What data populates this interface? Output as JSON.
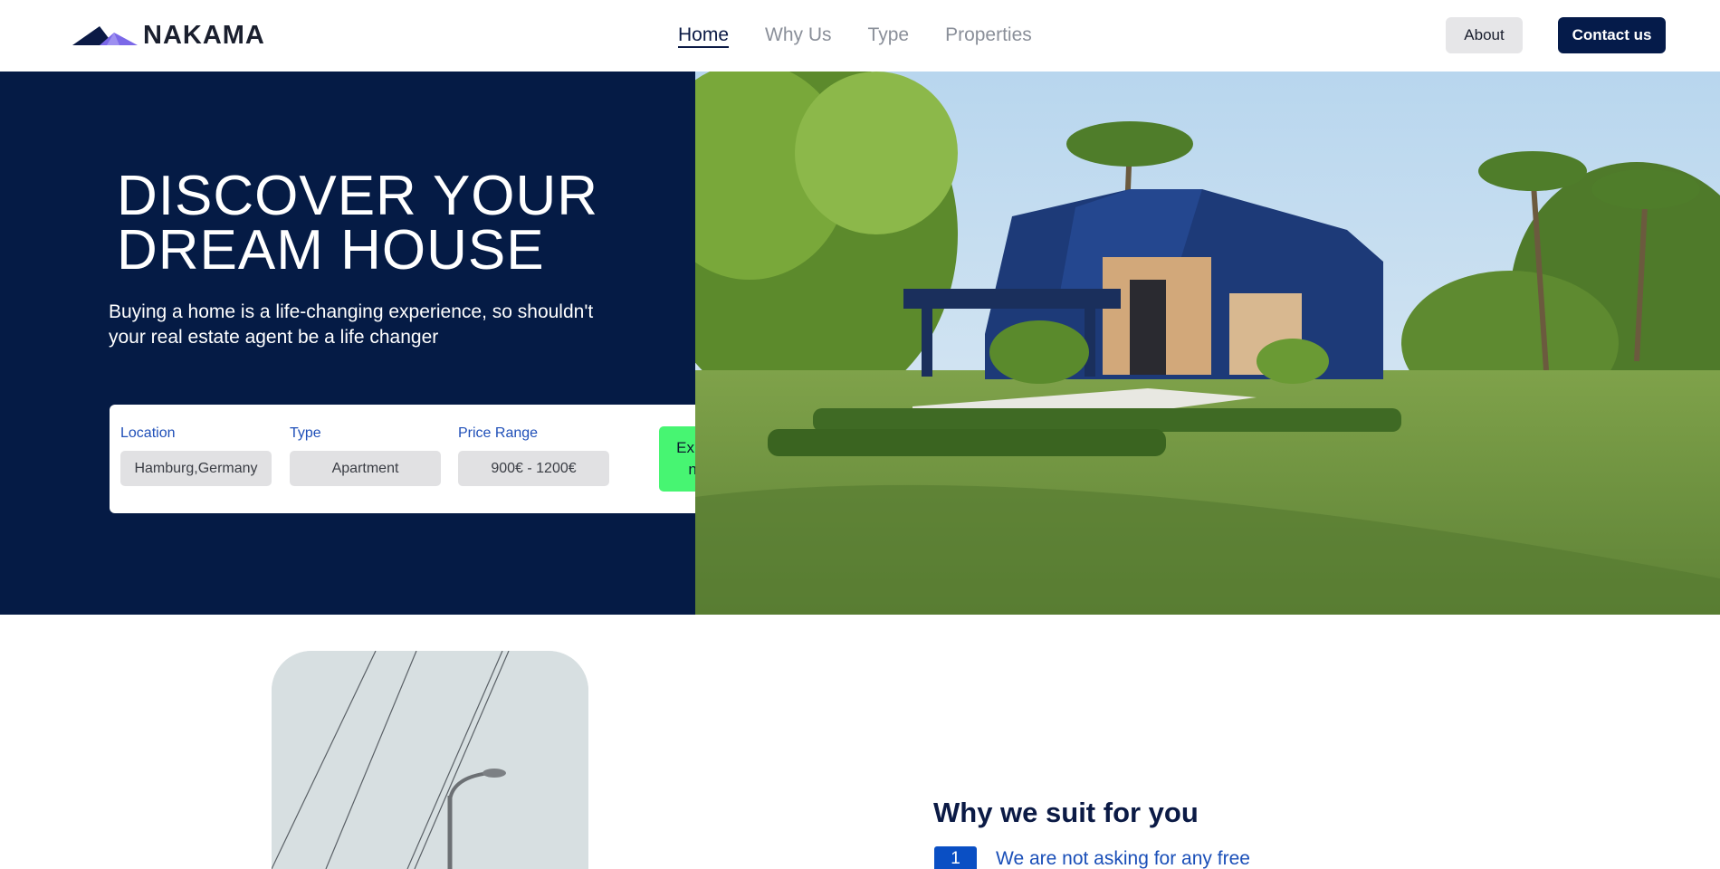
{
  "brand": {
    "name": "NAKAMA",
    "colors": {
      "navy": "#051b45",
      "accent_purple": "#7b68e8",
      "accent_green": "#47f572",
      "link_blue": "#1f4fb8"
    }
  },
  "nav": {
    "links": [
      {
        "label": "Home",
        "active": true
      },
      {
        "label": "Why Us",
        "active": false
      },
      {
        "label": "Type",
        "active": false
      },
      {
        "label": "Properties",
        "active": false
      }
    ],
    "about_label": "About",
    "contact_label": "Contact us"
  },
  "hero": {
    "title_line1": "DISCOVER YOUR",
    "title_line2": "DREAM HOUSE",
    "subtitle": "Buying a home is a life-changing experience, so shouldn't your real estate agent be a life changer",
    "image_icon": "modern-house-photo"
  },
  "search": {
    "location_label": "Location",
    "location_value": "Hamburg,Germany",
    "type_label": "Type",
    "type_value": "Apartment",
    "price_label": "Price Range",
    "price_value": "900€ - 1200€",
    "explore_label": "Explore now"
  },
  "why": {
    "title": "Why we suit for you",
    "items": [
      {
        "number": "1",
        "text": "We are not asking for any free"
      }
    ],
    "photo_icon": "street-lamp-photo"
  }
}
